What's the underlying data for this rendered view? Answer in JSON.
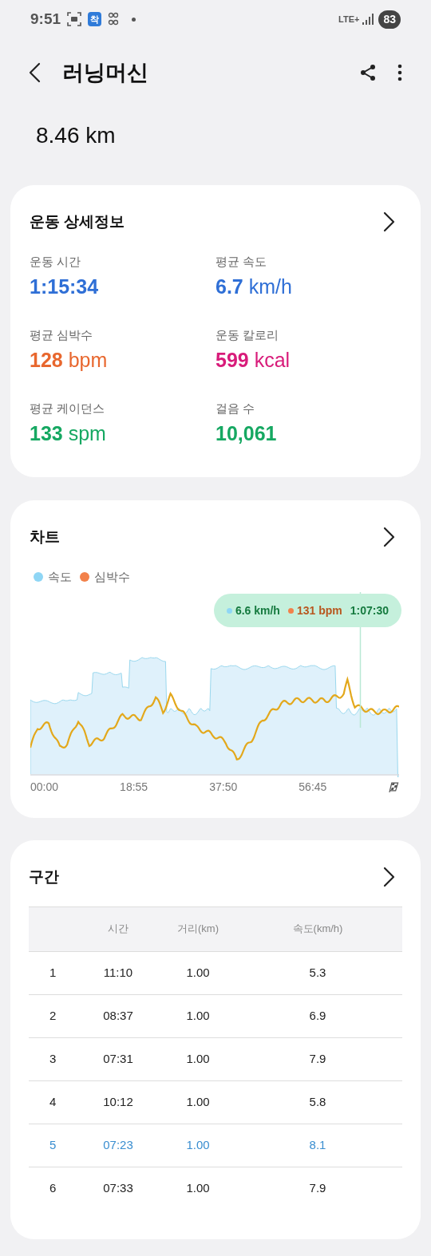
{
  "status_bar": {
    "time": "9:51",
    "app_badge": "착",
    "network": "LTE+",
    "battery": "83"
  },
  "header": {
    "title": "러닝머신"
  },
  "distance": "8.46 km",
  "details": {
    "title": "운동 상세정보",
    "stats": [
      {
        "label": "운동 시간",
        "value": "1:15:34",
        "color": "#2f6fd6"
      },
      {
        "label": "평균 속도",
        "value": "6.7",
        "unit": "km/h",
        "color": "#2f6fd6"
      },
      {
        "label": "평균 심박수",
        "value": "128",
        "unit": "bpm",
        "color": "#e8672e"
      },
      {
        "label": "운동 칼로리",
        "value": "599",
        "unit": "kcal",
        "color": "#d81b7a"
      },
      {
        "label": "평균 케이던스",
        "value": "133",
        "unit": "spm",
        "color": "#16a862"
      },
      {
        "label": "걸음 수",
        "value": "10,061",
        "color": "#16a862"
      }
    ]
  },
  "chart": {
    "title": "차트",
    "legend": [
      {
        "label": "속도",
        "color": "#8fd6f5"
      },
      {
        "label": "심박수",
        "color": "#f2814a"
      }
    ],
    "tooltip": {
      "speed": "6.6 km/h",
      "heart_rate": "131 bpm",
      "time": "1:07:30"
    },
    "x_labels": [
      "00:00",
      "18:55",
      "37:50",
      "56:45"
    ]
  },
  "laps": {
    "title": "구간",
    "columns": [
      "시간",
      "거리(km)",
      "속도(km/h)"
    ],
    "rows": [
      {
        "index": "1",
        "time": "11:10",
        "distance": "1.00",
        "speed": "5.3",
        "selected": false
      },
      {
        "index": "2",
        "time": "08:37",
        "distance": "1.00",
        "speed": "6.9",
        "selected": false
      },
      {
        "index": "3",
        "time": "07:31",
        "distance": "1.00",
        "speed": "7.9",
        "selected": false
      },
      {
        "index": "4",
        "time": "10:12",
        "distance": "1.00",
        "speed": "5.8",
        "selected": false
      },
      {
        "index": "5",
        "time": "07:23",
        "distance": "1.00",
        "speed": "8.1",
        "selected": true
      },
      {
        "index": "6",
        "time": "07:33",
        "distance": "1.00",
        "speed": "7.9",
        "selected": false
      }
    ]
  }
}
